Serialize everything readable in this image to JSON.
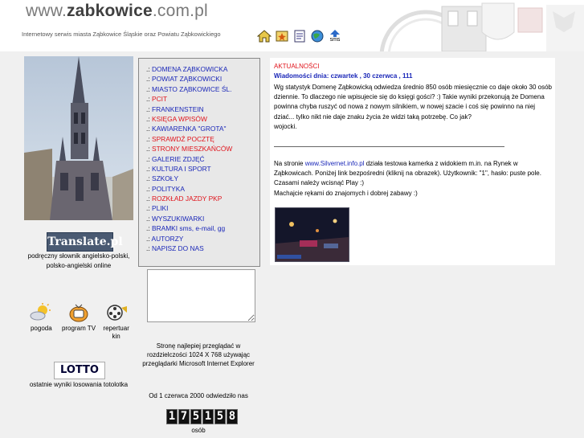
{
  "header": {
    "title_pre": "www.",
    "title_main": "zabkowice",
    "title_post": ".com.pl",
    "tagline": "Internetowy serwis miasta Ząbkowice Śląskie oraz Powiatu Ząbkowickiego",
    "icons": [
      "home-icon",
      "star-icon",
      "document-icon",
      "globe-icon",
      "sms-icon"
    ],
    "sms_label": "sms"
  },
  "left": {
    "translate_label": "Translate.pl",
    "translate_desc": "podręczny słownik angielsko-polski, polsko-angielski online",
    "weather_label": "pogoda",
    "tv_label": "program TV",
    "cinema_label": "repertuar kin",
    "lotto_logo": "LOTTO",
    "lotto_desc": "ostatnie wyniki losowania totolotka"
  },
  "menu": {
    "prefix": ".:",
    "items": [
      {
        "label": "DOMENA ZĄBKOWICKA",
        "color": "blue"
      },
      {
        "label": "POWIAT ZĄBKOWICKI",
        "color": "blue"
      },
      {
        "label": "MIASTO ZĄBKOWICE ŚL.",
        "color": "blue"
      },
      {
        "label": "PCIT",
        "color": "red"
      },
      {
        "label": "FRANKENSTEIN",
        "color": "blue"
      },
      {
        "label": "KSIĘGA WPISÓW",
        "color": "red"
      },
      {
        "label": "KAWIARENKA \"GROTA\"",
        "color": "blue"
      },
      {
        "label": "SPRAWDŹ POCZTĘ",
        "color": "red"
      },
      {
        "label": "STRONY MIESZKAŃCÓW",
        "color": "red"
      },
      {
        "label": "GALERIE ZDJĘĆ",
        "color": "blue"
      },
      {
        "label": "KULTURA I SPORT",
        "color": "blue"
      },
      {
        "label": "SZKOŁY",
        "color": "blue"
      },
      {
        "label": "POLITYKA",
        "color": "blue"
      },
      {
        "label": "ROZKŁAD JAZDY PKP",
        "color": "red"
      },
      {
        "label": "PLIKI",
        "color": "blue"
      },
      {
        "label": "WYSZUKIWARKI",
        "color": "blue"
      },
      {
        "label": "BRAMKI sms, e-mail, gg",
        "color": "blue"
      },
      {
        "label": "AUTORZY",
        "color": "blue"
      },
      {
        "label": "NAPISZ DO NAS",
        "color": "blue"
      }
    ],
    "textarea_value": ""
  },
  "footer": {
    "best_view": "Stronę najlepiej przeglądać w rozdzielczości 1024 X 768 używając przeglądarki Microsoft Internet Explorer",
    "since": "Od 1 czerwca 2000 odwiedziło nas",
    "counter_digits": [
      "1",
      "7",
      "5",
      "1",
      "5",
      "8"
    ],
    "osob": "osób"
  },
  "news": {
    "heading": "AKTUALNOŚCI",
    "date": "Wiadomości dnia: czwartek , 30 czerwca , 111",
    "body": "Wg statystyk Domenę Ząbkowicką odwiedza średnio 850 osób miesięcznie co daje około 30 osób dziennie. To dlaczego nie wpisujecie się do księgi gości? :) Takie wyniki przekonują że Domena powinna chyba ruszyć od nowa z nowym silnikiem, w nowej szacie i coś się powinno na niej dziać... tylko nikt nie daje znaku życia że widzi taką potrzebę. Co jak?",
    "author": "wojocki.",
    "cam_pre": "Na stronie ",
    "cam_link": "www.Silvernet.info.pl",
    "cam_post": " działa testowa kamerka z widokiem m.in. na Rynek w Ząbkowicach. Poniżej link bezpośredni (kliknij na obrazek). Użytkownik: \"1\", hasło: puste pole. Czasami należy wcisnąć Play :)",
    "cam_line2": "Machajcie rękami do znajomych i dobrej zabawy :)"
  },
  "colors": {
    "menu_blue": "#1a27b8",
    "menu_red": "#e0141c",
    "strip_gray": "#f0f0f0"
  }
}
